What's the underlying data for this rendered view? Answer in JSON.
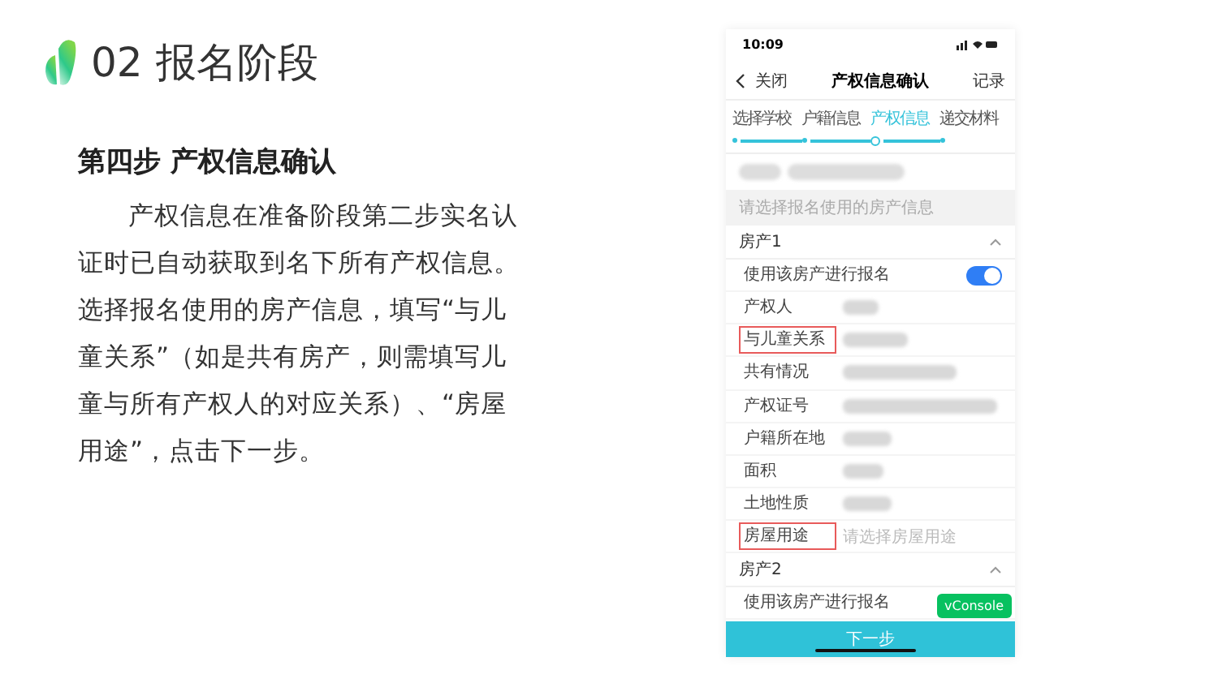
{
  "header": {
    "title": "02 报名阶段"
  },
  "step": {
    "title": "第四步 产权信息确认",
    "body": "产权信息在准备阶段第二步实名认证时已自动获取到名下所有产权信息。选择报名使用的房产信息，填写“与儿童关系”（如是共有房产，则需填写儿童与所有产权人的对应关系）、“房屋用途”，点击下一步。"
  },
  "phone": {
    "status_time": "10:09",
    "nav": {
      "back": "关闭",
      "title": "产权信息确认",
      "action": "记录"
    },
    "steps": [
      {
        "label": "选择学校",
        "selected": false
      },
      {
        "label": "户籍信息",
        "selected": false
      },
      {
        "label": "产权信息",
        "selected": true
      },
      {
        "label": "递交材料",
        "selected": false
      }
    ],
    "notice": "请选择报名使用的房产信息",
    "sections": [
      {
        "title": "房产1",
        "expanded": true,
        "rows": [
          {
            "kind": "toggle",
            "label": "使用该房产进行报名",
            "on": true,
            "highlighted": false
          },
          {
            "kind": "redacted",
            "label": "产权人",
            "highlighted": false
          },
          {
            "kind": "redacted",
            "label": "与儿童关系",
            "highlighted": true
          },
          {
            "kind": "redacted",
            "label": "共有情况",
            "highlighted": false
          },
          {
            "kind": "redacted",
            "label": "产权证号",
            "highlighted": false
          },
          {
            "kind": "redacted",
            "label": "户籍所在地",
            "highlighted": false
          },
          {
            "kind": "redacted",
            "label": "面积",
            "highlighted": false
          },
          {
            "kind": "redacted",
            "label": "土地性质",
            "highlighted": false
          },
          {
            "kind": "select",
            "label": "房屋用途",
            "placeholder": "请选择房屋用途",
            "highlighted": true
          }
        ]
      },
      {
        "title": "房产2",
        "expanded": true,
        "rows": [
          {
            "kind": "text",
            "label": "使用该房产进行报名",
            "highlighted": false
          }
        ]
      }
    ],
    "next_button": "下一步",
    "console_badge": "vConsole"
  }
}
